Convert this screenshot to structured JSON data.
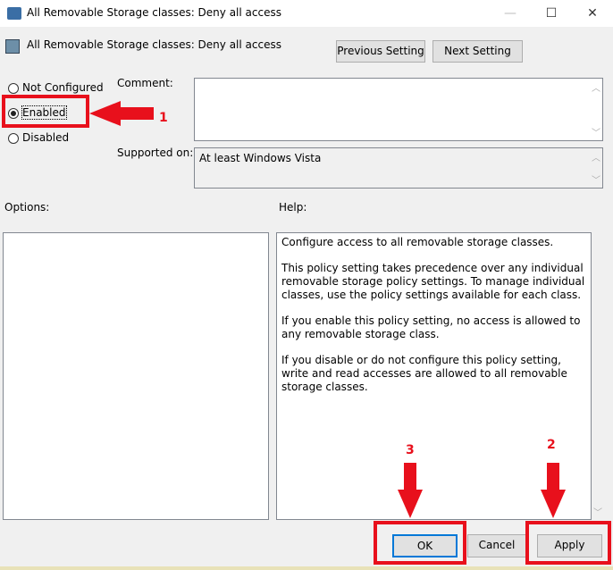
{
  "window": {
    "title": "All Removable Storage classes: Deny all access",
    "minimize": "—",
    "maximize": "☐",
    "close": "✕"
  },
  "header": {
    "title": "All Removable Storage classes: Deny all access",
    "prev": "Previous Setting",
    "next": "Next Setting"
  },
  "radios": [
    {
      "label": "Not Configured",
      "checked": false
    },
    {
      "label": "Enabled",
      "checked": true
    },
    {
      "label": "Disabled",
      "checked": false
    }
  ],
  "comment_label": "Comment:",
  "supported_label": "Supported on:",
  "supported_value": "At least Windows Vista",
  "options_label": "Options:",
  "help_label": "Help:",
  "help": [
    "Configure access to all removable storage classes.",
    "This policy setting takes precedence over any individual removable storage policy settings. To manage individual classes, use the policy settings available for each class.",
    "If you enable this policy setting, no access is allowed to any removable storage class.",
    "If you disable or do not configure this policy setting, write and read accesses are allowed to all removable storage classes."
  ],
  "buttons": {
    "ok": "OK",
    "cancel": "Cancel",
    "apply": "Apply"
  },
  "annotations": {
    "n1": "1",
    "n2": "2",
    "n3": "3",
    "color": "#e8101c"
  }
}
